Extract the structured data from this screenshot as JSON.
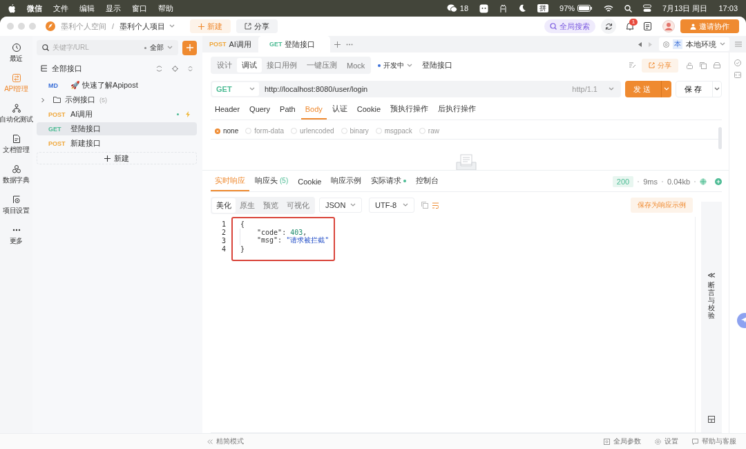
{
  "menu_bar": {
    "items": [
      "微信",
      "文件",
      "编辑",
      "显示",
      "窗口",
      "帮助"
    ],
    "wechat_count": "18",
    "input_method": "拼",
    "battery": "97%",
    "date": "7月13日 周日",
    "time": "17:03"
  },
  "title_bar": {
    "workspace": "墨利个人空间",
    "separator": "/",
    "project": "墨利个人项目",
    "new_button": "新建",
    "share_button": "分享",
    "global_search": "全局搜索",
    "notification_count": "1",
    "invite_button": "邀请协作"
  },
  "nav_rail": {
    "items": [
      {
        "label": "最近",
        "selected": false
      },
      {
        "label": "API管理",
        "selected": true
      },
      {
        "label": "自动化测试",
        "selected": false
      },
      {
        "label": "文档管理",
        "selected": false
      },
      {
        "label": "数据字典",
        "selected": false
      },
      {
        "label": "项目设置",
        "selected": false
      },
      {
        "label": "更多",
        "selected": false
      }
    ]
  },
  "api_tree": {
    "search_placeholder": "关键字/URL",
    "filter": "全部",
    "root": "全部接口",
    "items": [
      {
        "kind": "doc",
        "method": "MD",
        "color": "#3a6fd8",
        "label": "🚀 快速了解Apipost",
        "selected": false
      },
      {
        "kind": "folder",
        "label": "示例接口",
        "count": "(5)",
        "expanded": false,
        "selected": false
      },
      {
        "kind": "api",
        "method": "POST",
        "color": "#f0a83c",
        "label": "AI调用",
        "selected": false,
        "status_dot": true
      },
      {
        "kind": "api",
        "method": "GET",
        "color": "#4cbb94",
        "label": "登陆接口",
        "selected": true,
        "status_dot": false
      },
      {
        "kind": "api",
        "method": "POST",
        "color": "#f0a83c",
        "label": "新建接口",
        "selected": false,
        "status_dot": false
      }
    ],
    "add_button": "新建"
  },
  "tabs": [
    {
      "method": "POST",
      "color": "#f0a83c",
      "label": "AI调用",
      "selected": false
    },
    {
      "method": "GET",
      "color": "#4cbb94",
      "label": "登陆接口",
      "selected": true
    }
  ],
  "environment": {
    "badge": "本",
    "name": "本地环境"
  },
  "request": {
    "mode_tabs": [
      {
        "label": "设计",
        "selected": false
      },
      {
        "label": "调试",
        "selected": true
      },
      {
        "label": "接口用例",
        "selected": false
      },
      {
        "label": "一键压测",
        "selected": false
      },
      {
        "label": "Mock",
        "selected": false
      }
    ],
    "status": "开发中",
    "name": "登陆接口",
    "share_button": "分享",
    "method": "GET",
    "url": "http://localhost:8080/user/login",
    "protocol": "http/1.1",
    "send_button": "发送",
    "save_button": "保存",
    "param_tabs": [
      {
        "label": "Header",
        "selected": false
      },
      {
        "label": "Query",
        "selected": false
      },
      {
        "label": "Path",
        "selected": false
      },
      {
        "label": "Body",
        "selected": true
      },
      {
        "label": "认证",
        "selected": false
      },
      {
        "label": "Cookie",
        "selected": false
      },
      {
        "label": "预执行操作",
        "selected": false
      },
      {
        "label": "后执行操作",
        "selected": false
      }
    ],
    "body_types": [
      {
        "label": "none",
        "selected": true
      },
      {
        "label": "form-data",
        "selected": false
      },
      {
        "label": "urlencoded",
        "selected": false
      },
      {
        "label": "binary",
        "selected": false
      },
      {
        "label": "msgpack",
        "selected": false
      },
      {
        "label": "raw",
        "selected": false
      }
    ]
  },
  "response": {
    "tabs": [
      {
        "label": "实时响应",
        "selected": true
      },
      {
        "label": "响应头",
        "count": "(5)",
        "selected": false,
        "dot": false
      },
      {
        "label": "Cookie",
        "selected": false,
        "dot": false
      },
      {
        "label": "响应示例",
        "selected": false,
        "dot": false
      },
      {
        "label": "实际请求",
        "selected": false,
        "dot": true
      },
      {
        "label": "控制台",
        "selected": false,
        "dot": false
      }
    ],
    "status_code": "200",
    "duration": "9ms",
    "size": "0.04kb",
    "view_tabs": [
      {
        "label": "美化",
        "selected": true
      },
      {
        "label": "原生",
        "selected": false
      },
      {
        "label": "预览",
        "selected": false
      },
      {
        "label": "可视化",
        "selected": false
      }
    ],
    "format": "JSON",
    "encoding": "UTF-8",
    "save_example_button": "保存为响应示例",
    "code_highlighted": true,
    "code_lines": [
      {
        "number": "1",
        "indented": false,
        "tokens": [
          {
            "kind": "punct",
            "text": "{"
          }
        ]
      },
      {
        "number": "2",
        "indented": true,
        "tokens": [
          {
            "kind": "key",
            "text": "\"code\""
          },
          {
            "kind": "punct",
            "text": ": "
          },
          {
            "kind": "number",
            "text": "403"
          },
          {
            "kind": "punct",
            "text": ","
          }
        ]
      },
      {
        "number": "3",
        "indented": true,
        "tokens": [
          {
            "kind": "key",
            "text": "\"msg\""
          },
          {
            "kind": "punct",
            "text": ": "
          },
          {
            "kind": "string",
            "text": "\"请求被拦截\""
          }
        ]
      },
      {
        "number": "4",
        "indented": false,
        "tokens": [
          {
            "kind": "punct",
            "text": "}"
          }
        ]
      }
    ],
    "side_panel": {
      "toggle": "≪",
      "label": "断言与校验"
    }
  },
  "footer": {
    "compact_mode": "精简模式",
    "global_params": "全局参数",
    "settings": "设置",
    "help": "帮助与客服"
  }
}
